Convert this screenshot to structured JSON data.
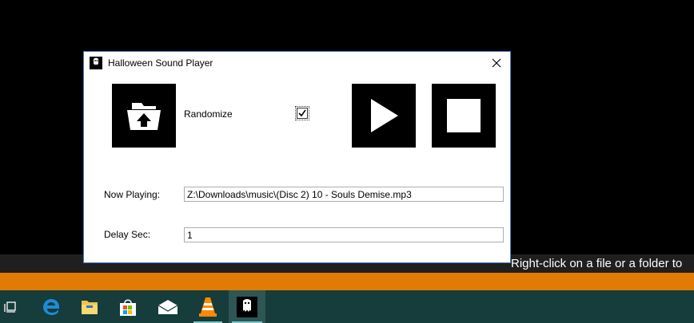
{
  "window": {
    "title": "Halloween Sound Player",
    "randomize_label": "Randomize",
    "randomize_checked": true,
    "now_playing_label": "Now Playing:",
    "now_playing_value": "Z:\\Downloads\\music\\(Disc 2) 10 - Souls Demise.mp3",
    "delay_label": "Delay Sec:",
    "delay_value": "1",
    "buttons": {
      "open": "folder-upload-icon",
      "play": "play-icon",
      "stop": "stop-icon"
    }
  },
  "desktop": {
    "hint": "Right-click on a file or a folder to"
  },
  "taskbar": {
    "items": [
      "task-view-icon",
      "edge-icon",
      "file-explorer-icon",
      "store-icon",
      "mail-icon",
      "vlc-icon",
      "halloween-player-icon"
    ]
  },
  "colors": {
    "accent_bar": "#e27b05",
    "taskbar": "#163c3b",
    "window_border": "#3b80c8"
  }
}
